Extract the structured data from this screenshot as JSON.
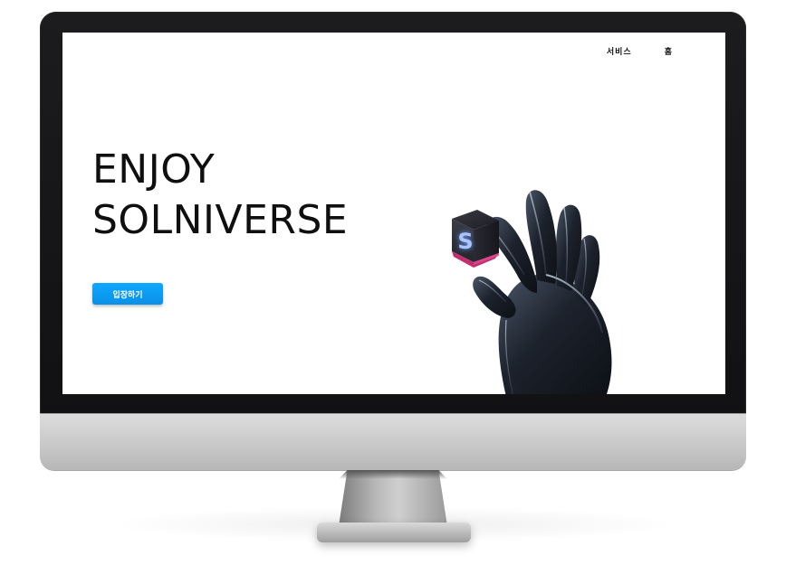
{
  "nav": {
    "items": [
      {
        "label": "서비스"
      },
      {
        "label": "홈"
      }
    ]
  },
  "hero": {
    "title_line1": "ENJOY",
    "title_line2": "SOLNIVERSE",
    "cta_label": "입장하기"
  },
  "cube": {
    "letter": "S"
  },
  "colors": {
    "accent": "#0a9cf5",
    "bezel": "#151517",
    "cube_magenta": "#c0306e",
    "glove": "#1e2530"
  }
}
